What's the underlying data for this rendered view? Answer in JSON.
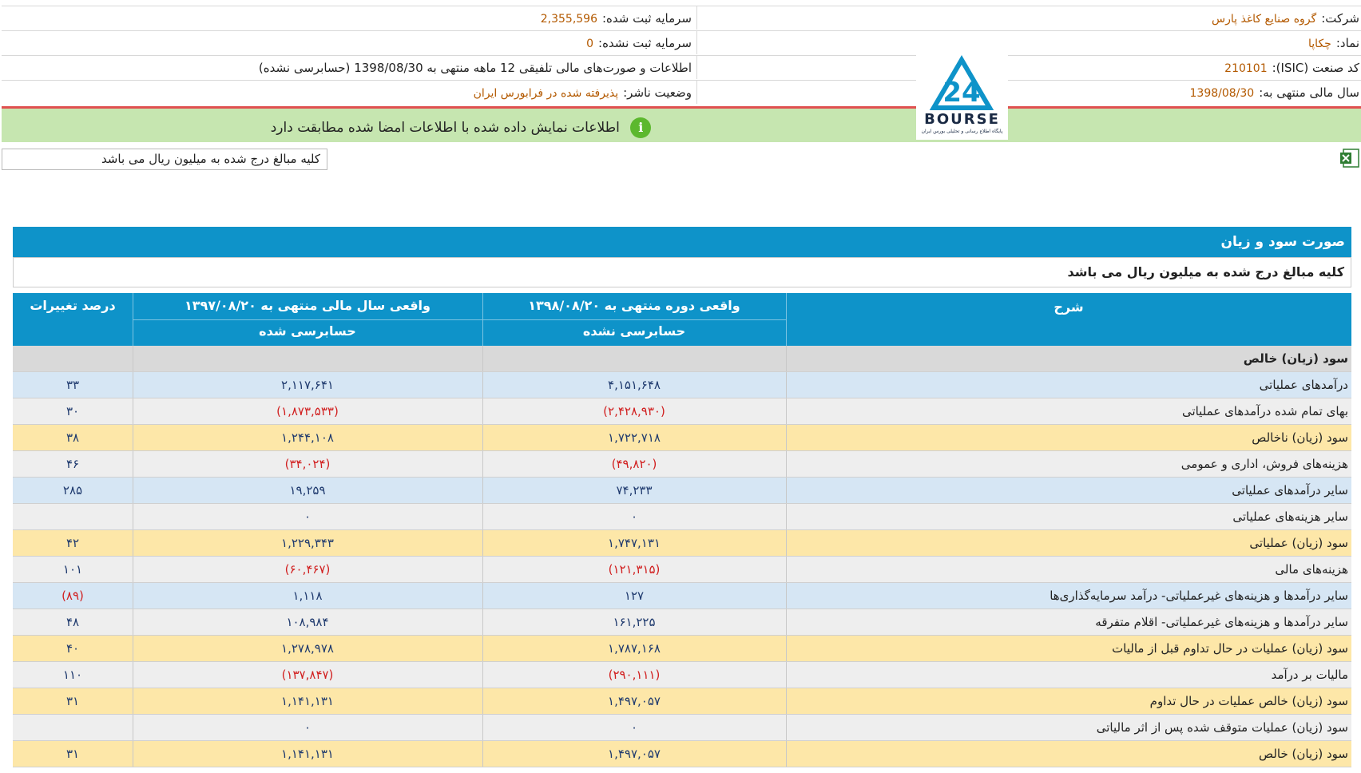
{
  "header": {
    "company_label": "شرکت:",
    "company_value": "گروه صنایع کاغذ پارس",
    "symbol_label": "نماد:",
    "symbol_value": "چکاپا",
    "isic_label": "کد صنعت (ISIC):",
    "isic_value": "210101",
    "fiscal_label": "سال مالی منتهی به:",
    "fiscal_value": "1398/08/30",
    "reg_capital_label": "سرمایه ثبت شده:",
    "reg_capital_value": "2,355,596",
    "unreg_capital_label": "سرمایه ثبت نشده:",
    "unreg_capital_value": "0",
    "statement_info": "اطلاعات و صورت‌های مالی تلفیقی 12 ماهه منتهی به 1398/08/30 (حسابرسی نشده)",
    "publisher_status_label": "وضعیت ناشر:",
    "publisher_status_value": "پذیرفته شده در فرابورس ایران"
  },
  "logo": {
    "word": "BOURSE",
    "number": "24",
    "tagline": "پایگاه اطلاع رسانی و تحلیلی بورس ایران"
  },
  "notice": {
    "message": "اطلاعات نمایش داده شده با اطلاعات امضا شده مطابقت دارد",
    "icon": "info-icon"
  },
  "amount_note": "کلیه مبالغ درج شده به میلیون ریال می باشد",
  "report": {
    "title": "صورت سود و زیان",
    "subtitle": "کلیه مبالغ درج شده به میلیون ریال می باشد",
    "columns": {
      "description": "شرح",
      "current": "واقعی دوره منتهی به ۱۳۹۸/۰۸/۲۰",
      "current_sub": "حسابرسی نشده",
      "previous": "واقعی سال مالی منتهی به ۱۳۹۷/۰۸/۲۰",
      "previous_sub": "حسابرسی شده",
      "change": "درصد تغییرات"
    },
    "section_title": "سود (زیان) خالص",
    "rows": [
      {
        "desc": "درآمدهای عملیاتی",
        "cur": "۴,۱۵۱,۶۴۸",
        "prev": "۲,۱۱۷,۶۴۱",
        "pct": "۳۳"
      },
      {
        "desc": "بهای تمام شده درآمدهای عملیاتی",
        "cur": "(۲,۴۲۸,۹۳۰)",
        "prev": "(۱,۸۷۳,۵۳۳)",
        "pct": "۳۰"
      },
      {
        "desc": "سود (زیان) ناخالص",
        "cur": "۱,۷۲۲,۷۱۸",
        "prev": "۱,۲۴۴,۱۰۸",
        "pct": "۳۸"
      },
      {
        "desc": "هزینه‌های فروش، اداری و عمومی",
        "cur": "(۴۹,۸۲۰)",
        "prev": "(۳۴,۰۲۴)",
        "pct": "۴۶"
      },
      {
        "desc": "سایر درآمدهای عملیاتی",
        "cur": "۷۴,۲۳۳",
        "prev": "۱۹,۲۵۹",
        "pct": "۲۸۵"
      },
      {
        "desc": "سایر هزینه‌های عملیاتی",
        "cur": "۰",
        "prev": "۰",
        "pct": ""
      },
      {
        "desc": "سود (زیان) عملیاتی",
        "cur": "۱,۷۴۷,۱۳۱",
        "prev": "۱,۲۲۹,۳۴۳",
        "pct": "۴۲"
      },
      {
        "desc": "هزینه‌های مالی",
        "cur": "(۱۲۱,۳۱۵)",
        "prev": "(۶۰,۴۶۷)",
        "pct": "۱۰۱"
      },
      {
        "desc": "سایر درآمدها و هزینه‌های غیرعملیاتی- درآمد سرمایه‌گذاری‌ها",
        "cur": "۱۲۷",
        "prev": "۱,۱۱۸",
        "pct": "(۸۹)"
      },
      {
        "desc": "سایر درآمدها و هزینه‌های غیرعملیاتی- اقلام متفرقه",
        "cur": "۱۶۱,۲۲۵",
        "prev": "۱۰۸,۹۸۴",
        "pct": "۴۸"
      },
      {
        "desc": "سود (زیان) عملیات در حال تداوم قبل از مالیات",
        "cur": "۱,۷۸۷,۱۶۸",
        "prev": "۱,۲۷۸,۹۷۸",
        "pct": "۴۰"
      },
      {
        "desc": "مالیات بر درآمد",
        "cur": "(۲۹۰,۱۱۱)",
        "prev": "(۱۳۷,۸۴۷)",
        "pct": "۱۱۰"
      },
      {
        "desc": "سود (زیان) خالص عملیات در حال تداوم",
        "cur": "۱,۴۹۷,۰۵۷",
        "prev": "۱,۱۴۱,۱۳۱",
        "pct": "۳۱"
      },
      {
        "desc": "سود (زیان) عملیات متوقف شده پس از اثر مالیاتی",
        "cur": "۰",
        "prev": "۰",
        "pct": ""
      },
      {
        "desc": "سود (زیان) خالص",
        "cur": "۱,۴۹۷,۰۵۷",
        "prev": "۱,۱۴۱,۱۳۱",
        "pct": "۳۱"
      }
    ]
  },
  "colors": {
    "accent": "#0e93c9",
    "notice_bg": "#c6e6b0",
    "negative": "#d11f1f",
    "value": "#b35900"
  }
}
